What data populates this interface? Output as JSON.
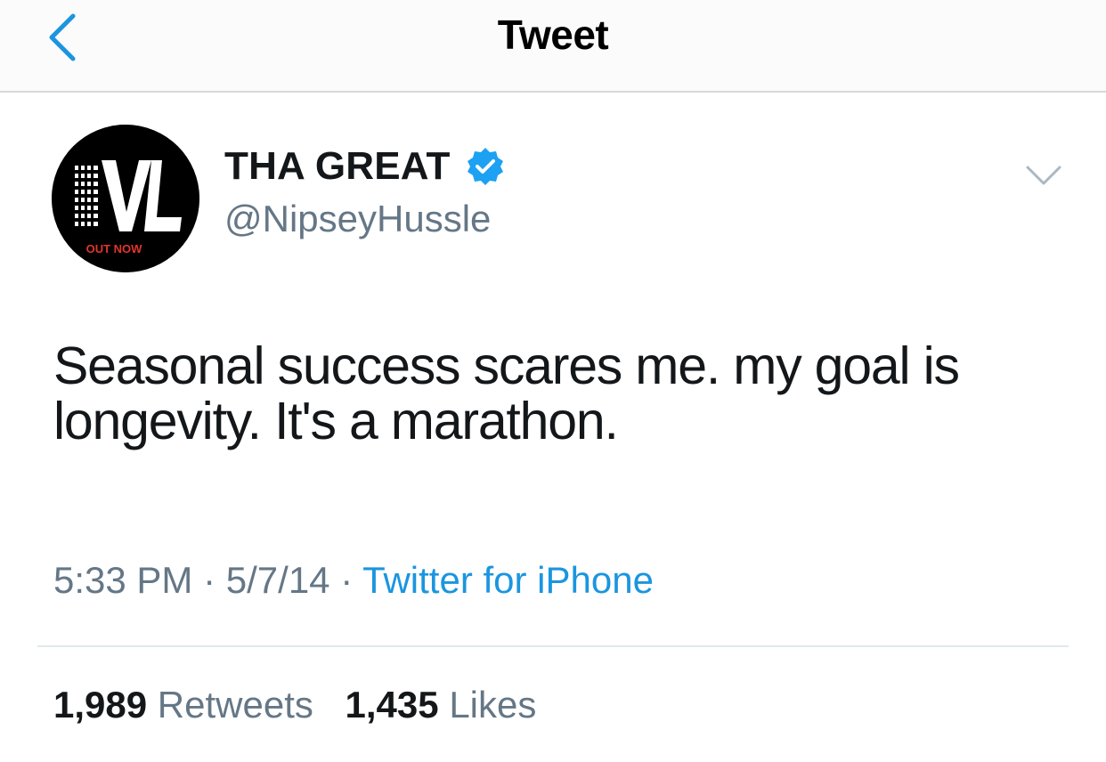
{
  "header": {
    "title": "Tweet",
    "back_icon": "chevron-left-icon"
  },
  "colors": {
    "accent": "#1b95e0",
    "secondary_text": "#657786",
    "primary_text": "#14171a",
    "verified": "#1da1f2"
  },
  "author": {
    "display_name": "THA GREAT",
    "handle": "@NipseyHussle",
    "verified": true,
    "avatar": {
      "logo_text": "VL",
      "badge_text": "OUT NOW"
    }
  },
  "tweet": {
    "text": "Seasonal success scares me. my goal is longevity. It's a marathon."
  },
  "meta": {
    "time": "5:33 PM",
    "separator": "·",
    "date": "5/7/14",
    "source": "Twitter for iPhone"
  },
  "stats": {
    "retweets_count": "1,989",
    "retweets_label": "Retweets",
    "likes_count": "1,435",
    "likes_label": "Likes"
  }
}
